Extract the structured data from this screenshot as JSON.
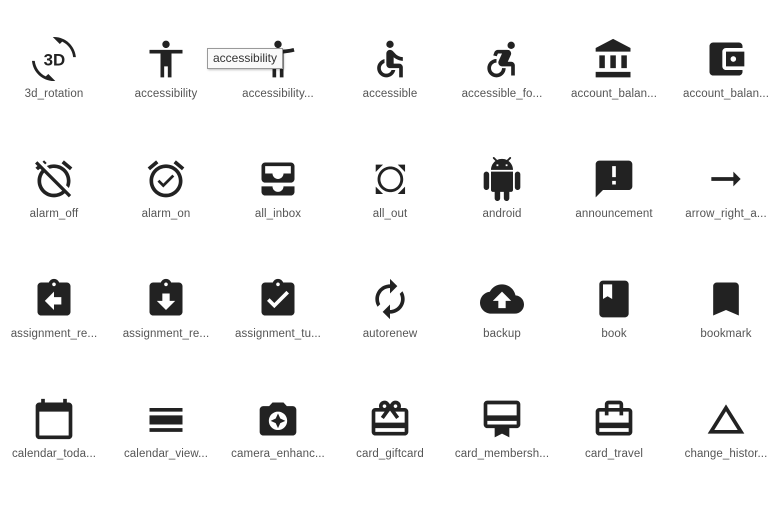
{
  "tooltip": "accessibility",
  "icons": [
    {
      "name": "3d-rotation-icon",
      "label": "3d_rotation"
    },
    {
      "name": "accessibility-icon",
      "label": "accessibility"
    },
    {
      "name": "accessibility-new-icon",
      "label": "accessibility..."
    },
    {
      "name": "accessible-icon",
      "label": "accessible"
    },
    {
      "name": "accessible-forward-icon",
      "label": "accessible_fo..."
    },
    {
      "name": "account-balance-icon",
      "label": "account_balan..."
    },
    {
      "name": "account-balance-wallet-icon",
      "label": "account_balan..."
    },
    {
      "name": "alarm-off-icon",
      "label": "alarm_off"
    },
    {
      "name": "alarm-on-icon",
      "label": "alarm_on"
    },
    {
      "name": "all-inbox-icon",
      "label": "all_inbox"
    },
    {
      "name": "all-out-icon",
      "label": "all_out"
    },
    {
      "name": "android-icon",
      "label": "android"
    },
    {
      "name": "announcement-icon",
      "label": "announcement"
    },
    {
      "name": "arrow-right-alt-icon",
      "label": "arrow_right_a..."
    },
    {
      "name": "assignment-return-icon",
      "label": "assignment_re..."
    },
    {
      "name": "assignment-returned-icon",
      "label": "assignment_re..."
    },
    {
      "name": "assignment-turned-in-icon",
      "label": "assignment_tu..."
    },
    {
      "name": "autorenew-icon",
      "label": "autorenew"
    },
    {
      "name": "backup-icon",
      "label": "backup"
    },
    {
      "name": "book-icon",
      "label": "book"
    },
    {
      "name": "bookmark-icon",
      "label": "bookmark"
    },
    {
      "name": "calendar-today-icon",
      "label": "calendar_toda..."
    },
    {
      "name": "calendar-view-day-icon",
      "label": "calendar_view..."
    },
    {
      "name": "camera-enhance-icon",
      "label": "camera_enhanc..."
    },
    {
      "name": "card-giftcard-icon",
      "label": "card_giftcard"
    },
    {
      "name": "card-membership-icon",
      "label": "card_membersh..."
    },
    {
      "name": "card-travel-icon",
      "label": "card_travel"
    },
    {
      "name": "change-history-icon",
      "label": "change_histor..."
    }
  ]
}
